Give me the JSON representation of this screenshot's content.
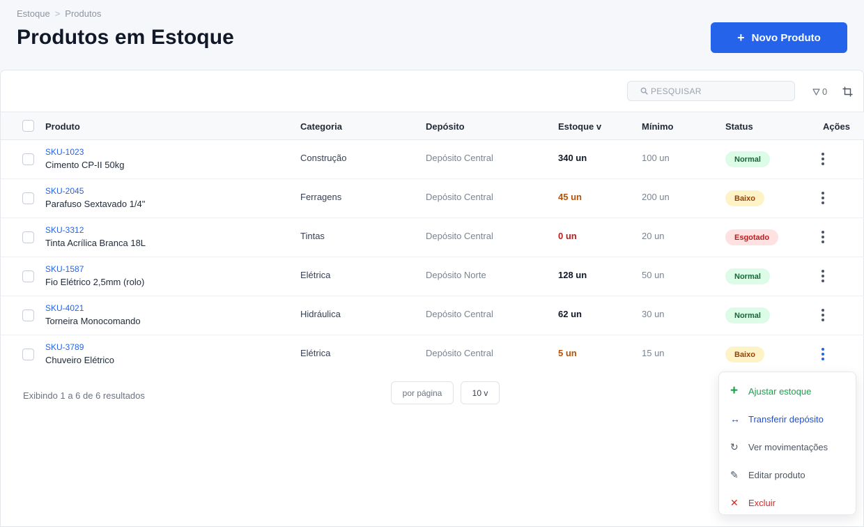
{
  "breadcrumb": {
    "parent": "Estoque",
    "separator": ">",
    "current": "Produtos"
  },
  "page": {
    "title": "Produtos em Estoque",
    "new_button": "Novo Produto",
    "new_button_icon": "+"
  },
  "toolbar": {
    "search_placeholder": "PESQUISAR",
    "filter_count": "0"
  },
  "table": {
    "headers": {
      "product": "Produto",
      "category": "Categoria",
      "warehouse": "Depósito",
      "stock": "Estoque v",
      "minimum": "Mínimo",
      "status": "Status",
      "actions": "Ações"
    },
    "rows": [
      {
        "sku": "SKU-1023",
        "name": "Cimento CP-II 50kg",
        "category": "Construção",
        "warehouse": "Depósito Central",
        "stock": "340 un",
        "minimum": "100 un",
        "status": "Normal",
        "level": "normal"
      },
      {
        "sku": "SKU-2045",
        "name": "Parafuso Sextavado 1/4\"",
        "category": "Ferragens",
        "warehouse": "Depósito Central",
        "stock": "45 un",
        "minimum": "200 un",
        "status": "Baixo",
        "level": "low"
      },
      {
        "sku": "SKU-3312",
        "name": "Tinta Acrílica Branca 18L",
        "category": "Tintas",
        "warehouse": "Depósito Central",
        "stock": "0 un",
        "minimum": "20 un",
        "status": "Esgotado",
        "level": "out"
      },
      {
        "sku": "SKU-1587",
        "name": "Fio Elétrico 2,5mm (rolo)",
        "category": "Elétrica",
        "warehouse": "Depósito Norte",
        "stock": "128 un",
        "minimum": "50 un",
        "status": "Normal",
        "level": "normal"
      },
      {
        "sku": "SKU-4021",
        "name": "Torneira Monocomando",
        "category": "Hidráulica",
        "warehouse": "Depósito Central",
        "stock": "62 un",
        "minimum": "30 un",
        "status": "Normal",
        "level": "normal"
      },
      {
        "sku": "SKU-3789",
        "name": "Chuveiro Elétrico",
        "category": "Elétrica",
        "warehouse": "Depósito Central",
        "stock": "5 un",
        "minimum": "15 un",
        "status": "Baixo",
        "level": "low"
      }
    ]
  },
  "footer": {
    "results": "Exibindo 1 a 6 de 6 resultados",
    "per_page_label": "por página",
    "page_size": "10 v"
  },
  "context_menu": {
    "items": [
      {
        "label": "Ajustar estoque",
        "icon": "+",
        "icon_name": "plus-icon",
        "tone": "green"
      },
      {
        "label": "Transferir depósito",
        "icon": "↔",
        "icon_name": "transfer-icon",
        "tone": "blue"
      },
      {
        "label": "Ver movimentações",
        "icon": "↻",
        "icon_name": "history-icon",
        "tone": "gray"
      },
      {
        "label": "Editar produto",
        "icon": "✎",
        "icon_name": "pencil-icon",
        "tone": "gray"
      },
      {
        "label": "Excluir",
        "icon": "✕",
        "icon_name": "delete-icon",
        "tone": "red"
      }
    ]
  },
  "colors": {
    "primary": "#2563eb",
    "normal_bg": "#dcfce7",
    "low_bg": "#fef3c7",
    "out_bg": "#fee2e2"
  }
}
